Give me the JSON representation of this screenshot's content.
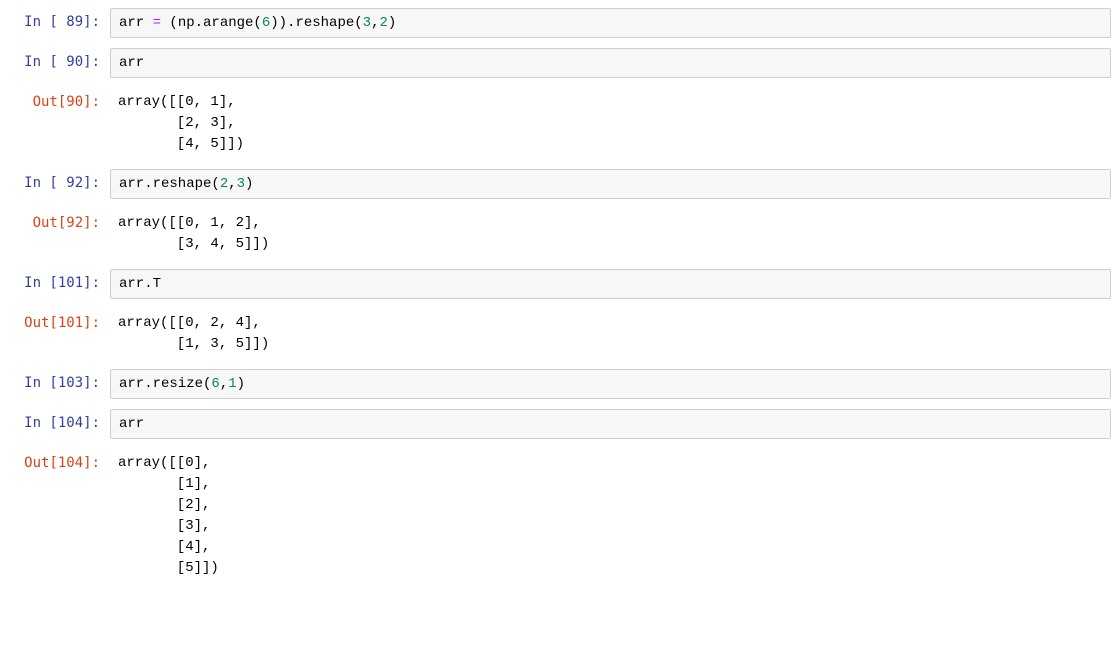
{
  "cells": [
    {
      "type": "in",
      "num": "89",
      "tokens": [
        {
          "t": "arr ",
          "c": "nv"
        },
        {
          "t": "=",
          "c": "op"
        },
        {
          "t": " (np.arange(",
          "c": "nv"
        },
        {
          "t": "6",
          "c": "num"
        },
        {
          "t": ")).reshape(",
          "c": "nv"
        },
        {
          "t": "3",
          "c": "num"
        },
        {
          "t": ",",
          "c": "nv"
        },
        {
          "t": "2",
          "c": "num"
        },
        {
          "t": ")",
          "c": "nv"
        }
      ]
    },
    {
      "type": "in",
      "num": "90",
      "tokens": [
        {
          "t": "arr",
          "c": "nv"
        }
      ]
    },
    {
      "type": "out",
      "num": "90",
      "text": "array([[0, 1],\n       [2, 3],\n       [4, 5]])"
    },
    {
      "type": "in",
      "num": "92",
      "tokens": [
        {
          "t": "arr.reshape(",
          "c": "nv"
        },
        {
          "t": "2",
          "c": "num"
        },
        {
          "t": ",",
          "c": "nv"
        },
        {
          "t": "3",
          "c": "num"
        },
        {
          "t": ")",
          "c": "nv"
        }
      ]
    },
    {
      "type": "out",
      "num": "92",
      "text": "array([[0, 1, 2],\n       [3, 4, 5]])"
    },
    {
      "type": "in",
      "num": "101",
      "tokens": [
        {
          "t": "arr.T",
          "c": "nv"
        }
      ]
    },
    {
      "type": "out",
      "num": "101",
      "text": "array([[0, 2, 4],\n       [1, 3, 5]])"
    },
    {
      "type": "in",
      "num": "103",
      "tokens": [
        {
          "t": "arr.resize(",
          "c": "nv"
        },
        {
          "t": "6",
          "c": "num"
        },
        {
          "t": ",",
          "c": "nv"
        },
        {
          "t": "1",
          "c": "num"
        },
        {
          "t": ")",
          "c": "nv"
        }
      ]
    },
    {
      "type": "in",
      "num": "104",
      "tokens": [
        {
          "t": "arr",
          "c": "nv"
        }
      ]
    },
    {
      "type": "out",
      "num": "104",
      "text": "array([[0],\n       [1],\n       [2],\n       [3],\n       [4],\n       [5]])"
    }
  ],
  "labels": {
    "in_prefix": "In ",
    "out_prefix": "Out"
  }
}
